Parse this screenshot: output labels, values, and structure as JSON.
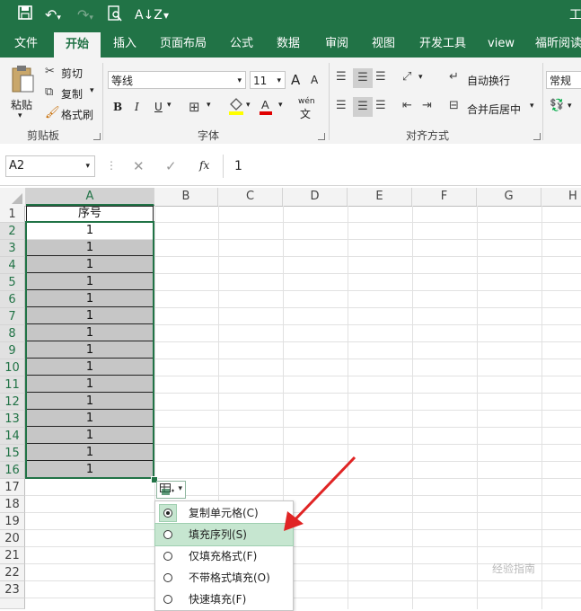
{
  "titlebar": {
    "title_fragment": "工"
  },
  "tabs": [
    "文件",
    "开始",
    "插入",
    "页面布局",
    "公式",
    "数据",
    "审阅",
    "视图",
    "开发工具",
    "view",
    "福昕阅读"
  ],
  "clipboard": {
    "paste": "粘贴",
    "cut": "剪切",
    "copy": "复制",
    "format_painter": "格式刷",
    "group": "剪贴板"
  },
  "font": {
    "name": "等线",
    "size": "11",
    "grow": "A",
    "shrink": "A",
    "bold": "B",
    "italic": "I",
    "underline": "U",
    "wen": "wén",
    "group": "字体"
  },
  "alignment": {
    "wrap": "自动换行",
    "merge": "合并后居中",
    "group": "对齐方式"
  },
  "number": {
    "format": "常规"
  },
  "formula": {
    "namebox": "A2",
    "fx": "fx",
    "value": "1"
  },
  "columns": [
    "A",
    "B",
    "C",
    "D",
    "E",
    "F",
    "G",
    "H"
  ],
  "rows": [
    "1",
    "2",
    "3",
    "4",
    "5",
    "6",
    "7",
    "8",
    "9",
    "10",
    "11",
    "12",
    "13",
    "14",
    "15",
    "16",
    "17",
    "18",
    "19",
    "20",
    "21",
    "22",
    "23"
  ],
  "cells": {
    "A1": "序号",
    "A_values": [
      "1",
      "1",
      "1",
      "1",
      "1",
      "1",
      "1",
      "1",
      "1",
      "1",
      "1",
      "1",
      "1",
      "1",
      "1"
    ]
  },
  "autofill_menu": {
    "items": [
      "复制单元格(C)",
      "填充序列(S)",
      "仅填充格式(F)",
      "不带格式填充(O)",
      "快速填充(F)"
    ],
    "selected": 0,
    "highlighted": 1
  },
  "watermark": "经验指南"
}
